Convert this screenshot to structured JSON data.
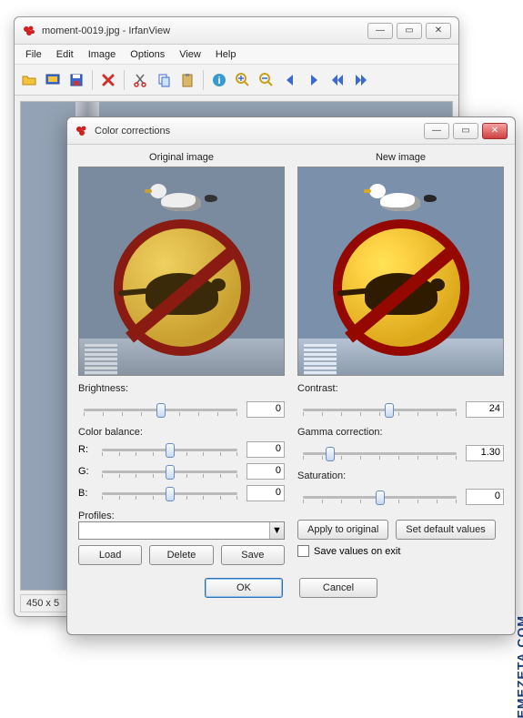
{
  "main": {
    "title": "moment-0019.jpg - IrfanView",
    "menu": [
      "File",
      "Edit",
      "Image",
      "Options",
      "View",
      "Help"
    ],
    "toolbar_icons": [
      "open",
      "slideshow",
      "save",
      "delete",
      "cut",
      "copy",
      "paste",
      "info",
      "zoom-in",
      "zoom-out",
      "prev",
      "next",
      "prev-page",
      "next-page"
    ],
    "status": "450 x 5"
  },
  "dialog": {
    "title": "Color corrections",
    "left_title": "Original image",
    "right_title": "New image",
    "brightness_label": "Brightness:",
    "brightness_value": "0",
    "colorbalance_label": "Color balance:",
    "r_label": "R:",
    "r_value": "0",
    "g_label": "G:",
    "g_value": "0",
    "b_label": "B:",
    "b_value": "0",
    "profiles_label": "Profiles:",
    "profiles_value": "",
    "load_btn": "Load",
    "delete_btn": "Delete",
    "save_btn": "Save",
    "contrast_label": "Contrast:",
    "contrast_value": "24",
    "gamma_label": "Gamma correction:",
    "gamma_value": "1.30",
    "saturation_label": "Saturation:",
    "saturation_value": "0",
    "apply_btn": "Apply to original",
    "defaults_btn": "Set default values",
    "save_exit_label": "Save values on exit",
    "ok_btn": "OK",
    "cancel_btn": "Cancel"
  },
  "slider_positions": {
    "brightness": 50,
    "r": 50,
    "g": 50,
    "b": 50,
    "contrast": 56,
    "gamma": 20,
    "saturation": 50
  },
  "watermark": "EMEZETA.COM"
}
